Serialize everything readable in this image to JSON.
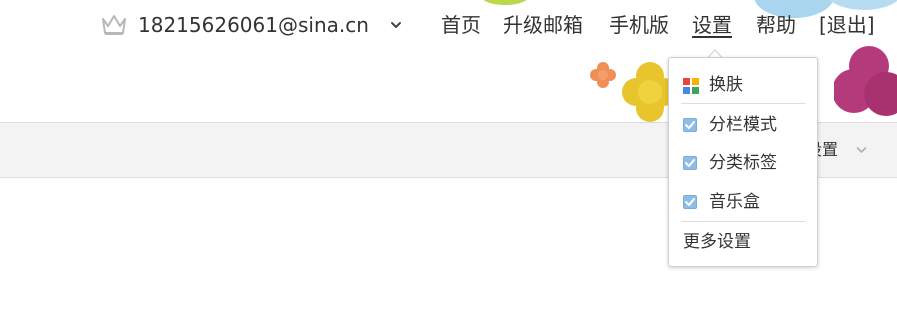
{
  "account": {
    "email": "18215626061@sina.cn",
    "crown_icon": "crown-icon",
    "caret_icon": "chevron-down-icon"
  },
  "nav": {
    "items": [
      {
        "label": "首页"
      },
      {
        "label": "升级邮箱"
      },
      {
        "label": "手机版"
      },
      {
        "label": "设置",
        "active": true
      },
      {
        "label": "帮助"
      },
      {
        "label": "[退出]"
      }
    ]
  },
  "toolbar": {
    "settings_label": "设置",
    "caret_icon": "chevron-down-icon"
  },
  "settings_menu": {
    "skin": {
      "label": "换肤",
      "icon": "palette-icon"
    },
    "options": [
      {
        "label": "分栏模式",
        "checked": true
      },
      {
        "label": "分类标签",
        "checked": true
      },
      {
        "label": "音乐盒",
        "checked": true
      }
    ],
    "more_label": "更多设置"
  },
  "colors": {
    "text": "#333333",
    "checkbox_fill": "#8fbde6",
    "toolbar_bg": "#f3f3f3",
    "skin_red": "#e9463a",
    "skin_yellow": "#f5b400",
    "skin_blue": "#4a86e8",
    "skin_green": "#3ba55c"
  }
}
